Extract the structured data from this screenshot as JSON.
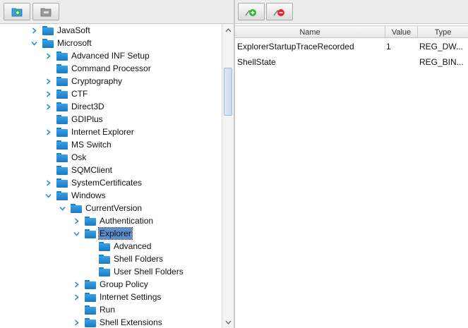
{
  "left_toolbar": {
    "add_key_icon": "folder-add-icon",
    "remove_key_icon": "folder-remove-icon"
  },
  "right_toolbar": {
    "add_value_icon": "value-add-icon",
    "remove_value_icon": "value-remove-icon"
  },
  "tree": {
    "nodes": [
      {
        "label": "JavaSoft",
        "toggle": "collapsed"
      },
      {
        "label": "Microsoft",
        "toggle": "expanded"
      },
      {
        "label": "Advanced INF Setup",
        "toggle": "collapsed"
      },
      {
        "label": "Command Processor",
        "toggle": "none"
      },
      {
        "label": "Cryptography",
        "toggle": "collapsed"
      },
      {
        "label": "CTF",
        "toggle": "collapsed"
      },
      {
        "label": "Direct3D",
        "toggle": "collapsed"
      },
      {
        "label": "GDIPlus",
        "toggle": "none"
      },
      {
        "label": "Internet Explorer",
        "toggle": "collapsed"
      },
      {
        "label": "MS Switch",
        "toggle": "none"
      },
      {
        "label": "Osk",
        "toggle": "none"
      },
      {
        "label": "SQMClient",
        "toggle": "none"
      },
      {
        "label": "SystemCertificates",
        "toggle": "collapsed"
      },
      {
        "label": "Windows",
        "toggle": "expanded"
      },
      {
        "label": "CurrentVersion",
        "toggle": "expanded"
      },
      {
        "label": "Authentication",
        "toggle": "collapsed"
      },
      {
        "label": "Explorer",
        "toggle": "expanded",
        "selected": true
      },
      {
        "label": "Advanced",
        "toggle": "none"
      },
      {
        "label": "Shell Folders",
        "toggle": "none"
      },
      {
        "label": "User Shell Folders",
        "toggle": "none"
      },
      {
        "label": "Group Policy",
        "toggle": "collapsed"
      },
      {
        "label": "Internet Settings",
        "toggle": "collapsed"
      },
      {
        "label": "Run",
        "toggle": "none"
      },
      {
        "label": "Shell Extensions",
        "toggle": "collapsed"
      }
    ]
  },
  "table": {
    "columns": [
      "Name",
      "Value",
      "Type"
    ],
    "rows": [
      {
        "name": "ExplorerStartupTraceRecorded",
        "value": "1",
        "type": "REG_DW..."
      },
      {
        "name": "ShellState",
        "value": "",
        "type": "REG_BIN..."
      }
    ]
  },
  "colors": {
    "folder": "#1a78c2",
    "selection": "#5b8fd0",
    "toggle_arrow": "#2a8fd8"
  }
}
